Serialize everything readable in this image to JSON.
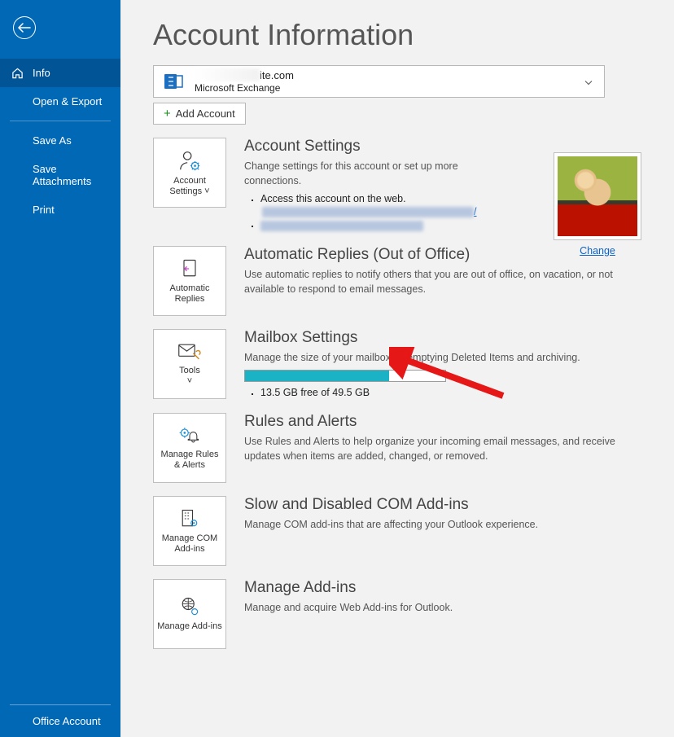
{
  "sidebar": {
    "info": "Info",
    "open_export": "Open & Export",
    "save_as": "Save As",
    "save_attachments": "Save Attachments",
    "print": "Print",
    "office_account": "Office Account"
  },
  "page_title": "Account Information",
  "account": {
    "email_suffix": "ite.com",
    "type": "Microsoft Exchange",
    "add_account": "Add Account"
  },
  "sections": {
    "account_settings": {
      "tile": "Account Settings",
      "title": "Account Settings",
      "desc": "Change settings for this account or set up more connections.",
      "bullet1": "Access this account on the web.",
      "link_suffix": "/",
      "change": "Change"
    },
    "auto_replies": {
      "tile": "Automatic Replies",
      "title": "Automatic Replies (Out of Office)",
      "desc": "Use automatic replies to notify others that you are out of office, on vacation, or not available to respond to email messages."
    },
    "mailbox": {
      "tile": "Tools",
      "title": "Mailbox Settings",
      "desc": "Manage the size of your mailbox by emptying Deleted Items and archiving.",
      "usage": "13.5 GB free of 49.5 GB",
      "fill_percent": 72
    },
    "rules": {
      "tile": "Manage Rules & Alerts",
      "title": "Rules and Alerts",
      "desc": "Use Rules and Alerts to help organize your incoming email messages, and receive updates when items are added, changed, or removed."
    },
    "com_addins": {
      "tile": "Manage COM Add-ins",
      "title": "Slow and Disabled COM Add-ins",
      "desc": "Manage COM add-ins that are affecting your Outlook experience."
    },
    "addins": {
      "tile": "Manage Add-ins",
      "title": "Manage Add-ins",
      "desc": "Manage and acquire Web Add-ins for Outlook."
    }
  }
}
